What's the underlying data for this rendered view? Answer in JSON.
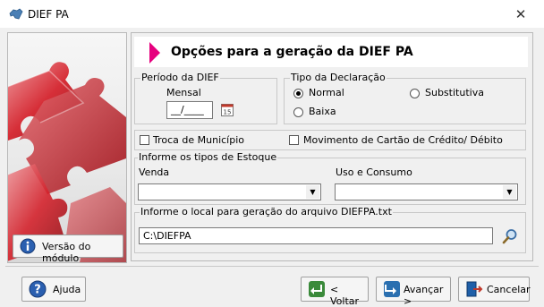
{
  "window": {
    "title": "DIEF PA",
    "close_glyph": "✕"
  },
  "header": {
    "title": "Opções para a geração da DIEF PA"
  },
  "periodo": {
    "legend": "Período da DIEF",
    "mensal_label": "Mensal",
    "date_value": "__/____"
  },
  "tipo": {
    "legend": "Tipo da Declaração",
    "normal": "Normal",
    "substitutiva": "Substitutiva",
    "baixa": "Baixa",
    "selected": "Normal"
  },
  "checks": {
    "troca": "Troca de Município",
    "movimento": "Movimento de Cartão de Crédito/ Débito"
  },
  "estoque": {
    "legend": "Informe os tipos de Estoque",
    "venda_label": "Venda",
    "uso_label": "Uso e Consumo",
    "venda_value": "",
    "uso_value": ""
  },
  "local": {
    "legend": "Informe o local para geração do arquivo DIEFPA.txt",
    "path_value": "C:\\DIEFPA"
  },
  "left": {
    "version_button": "Versão do módulo"
  },
  "buttons": {
    "help": "Ajuda",
    "back": "< Voltar",
    "next": "Avançar >",
    "cancel": "Cancelar"
  },
  "colors": {
    "accent": "#e6007e",
    "puzzle": "#c8141e"
  },
  "icons": {
    "app": "map-icon",
    "info": "info-icon",
    "calendar": "calendar-icon",
    "search": "search-icon",
    "help": "help-icon",
    "back": "back-arrow-icon",
    "next": "next-arrow-icon",
    "cancel": "exit-icon",
    "dropdown": "chevron-down-icon",
    "close": "close-icon",
    "header": "arrow-right-icon"
  }
}
